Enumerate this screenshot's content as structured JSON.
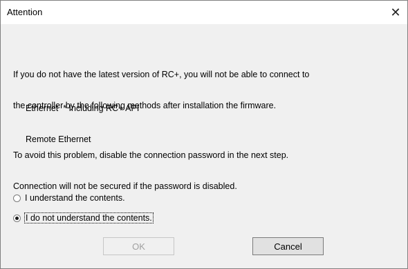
{
  "window": {
    "title": "Attention",
    "close_glyph": "✕"
  },
  "message": {
    "para1_line1": "If you do not have the latest version of RC+, you will not be able to connect to",
    "para1_line2": "the controller by the following methods after installation the firmware.",
    "method1": "Ethernet  * Including RC+ API",
    "method2": "Remote Ethernet",
    "para2_line1": "To avoid this problem, disable the connection password in the next step.",
    "para2_line2": "Connection will not be secured if the password is disabled."
  },
  "options": [
    {
      "label": "I understand the contents.",
      "checked": false
    },
    {
      "label": "I do not understand the contents.",
      "checked": true
    }
  ],
  "buttons": {
    "ok_label": "OK",
    "ok_enabled": false,
    "cancel_label": "Cancel"
  }
}
